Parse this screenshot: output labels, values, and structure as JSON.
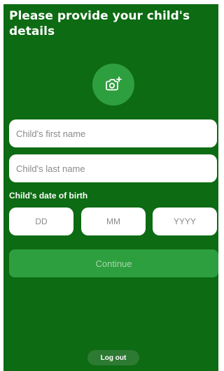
{
  "header": {
    "title": "Please provide your child's details"
  },
  "photo_button": {
    "icon": "camera-plus-icon"
  },
  "form": {
    "first_name_placeholder": "Child's first name",
    "first_name_value": "",
    "last_name_placeholder": "Child's last name",
    "last_name_value": "",
    "dob_label": "Child's date of birth",
    "dob_day_placeholder": "DD",
    "dob_month_placeholder": "MM",
    "dob_year_placeholder": "YYYY",
    "continue_label": "Continue"
  },
  "footer": {
    "logout_label": "Log out"
  },
  "colors": {
    "background": "#0d6b13",
    "accent": "#2e9f3e",
    "field_background": "#ffffff",
    "continue_text_disabled": "#a8d8ae"
  }
}
